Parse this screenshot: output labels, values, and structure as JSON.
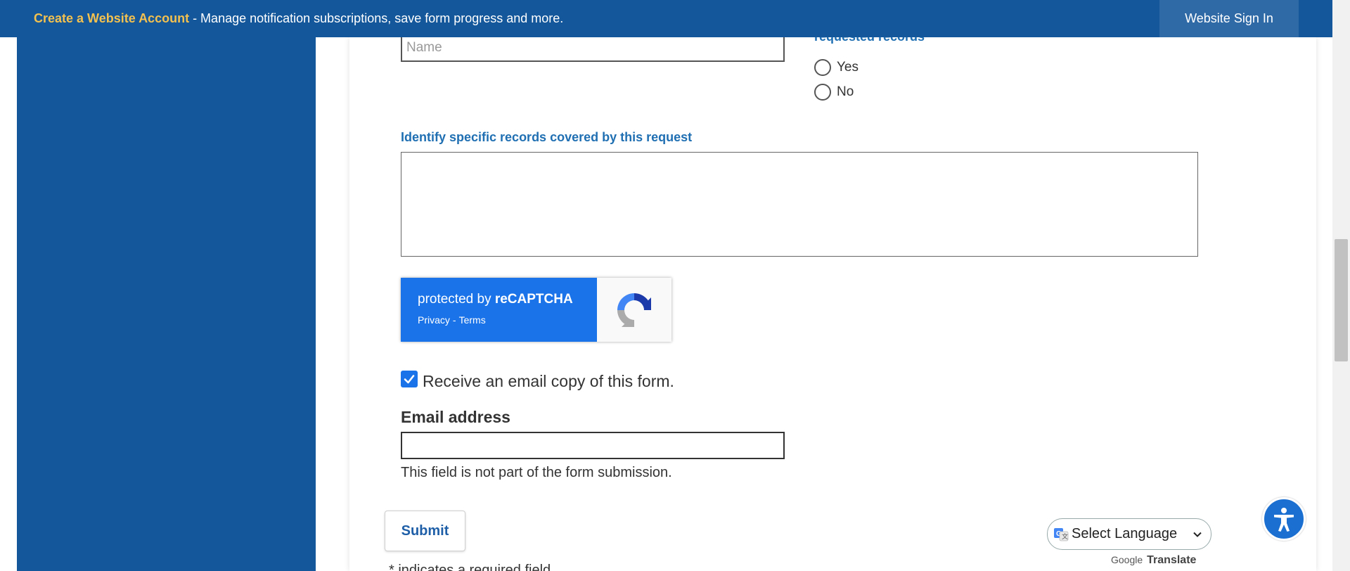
{
  "topbar": {
    "create_account_link": "Create a Website Account",
    "message": " - Manage notification subscriptions, save form progress and more.",
    "sign_in_label": "Website Sign In"
  },
  "form": {
    "name_placeholder": "Name",
    "requested_records_label": "requested records",
    "radio_options": [
      "Yes",
      "No"
    ],
    "records_label": "Identify specific records covered by this request",
    "records_value": "",
    "recaptcha": {
      "title_prefix": "protected by ",
      "title_brand": "reCAPTCHA",
      "privacy": "Privacy",
      "separator": "-",
      "terms": "Terms"
    },
    "email_copy_label": "Receive an email copy of this form.",
    "email_copy_checked": true,
    "email_label": "Email address",
    "email_value": "",
    "email_note": "This field is not part of the form submission.",
    "submit_label": "Submit",
    "required_note": "* indicates a required field"
  },
  "translate": {
    "select_label": "Select Language",
    "google_label": "Google",
    "translate_label": "Translate"
  },
  "icons": {
    "recaptcha": "recaptcha-logo-icon",
    "translate": "google-translate-icon",
    "accessibility": "accessibility-icon",
    "dropdown": "chevron-down-icon"
  },
  "colors": {
    "brand_blue": "#14579a",
    "account_link": "#f3c14f",
    "label_blue": "#1f6fb2",
    "recaptcha_blue": "#1a73e8",
    "accessibility_blue": "#1a6fd0"
  }
}
